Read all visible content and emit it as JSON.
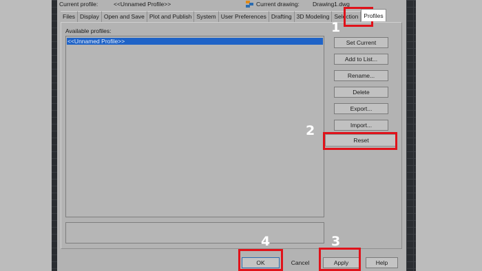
{
  "header": {
    "current_profile_label": "Current profile:",
    "current_profile_value": "<<Unnamed Profile>>",
    "current_drawing_label": "Current drawing:",
    "current_drawing_value": "Drawing1.dwg"
  },
  "tabs": [
    {
      "label": "Files"
    },
    {
      "label": "Display"
    },
    {
      "label": "Open and Save"
    },
    {
      "label": "Plot and Publish"
    },
    {
      "label": "System"
    },
    {
      "label": "User Preferences"
    },
    {
      "label": "Drafting"
    },
    {
      "label": "3D Modeling"
    },
    {
      "label": "Selection"
    },
    {
      "label": "Profiles"
    }
  ],
  "profiles": {
    "label": "Available profiles:",
    "items": [
      "<<Unnamed Profile>>"
    ]
  },
  "buttons": {
    "set_current": "Set Current",
    "add_to_list": "Add to List...",
    "rename": "Rename...",
    "delete": "Delete",
    "export": "Export...",
    "import": "Import...",
    "reset": "Reset",
    "ok": "OK",
    "cancel": "Cancel",
    "apply": "Apply",
    "help": "Help"
  },
  "callouts": [
    "1",
    "2",
    "3",
    "4"
  ],
  "colors": {
    "callout": "#e0121a",
    "selection": "#1f63c7",
    "dialog_bg": "#b3b3b3"
  }
}
